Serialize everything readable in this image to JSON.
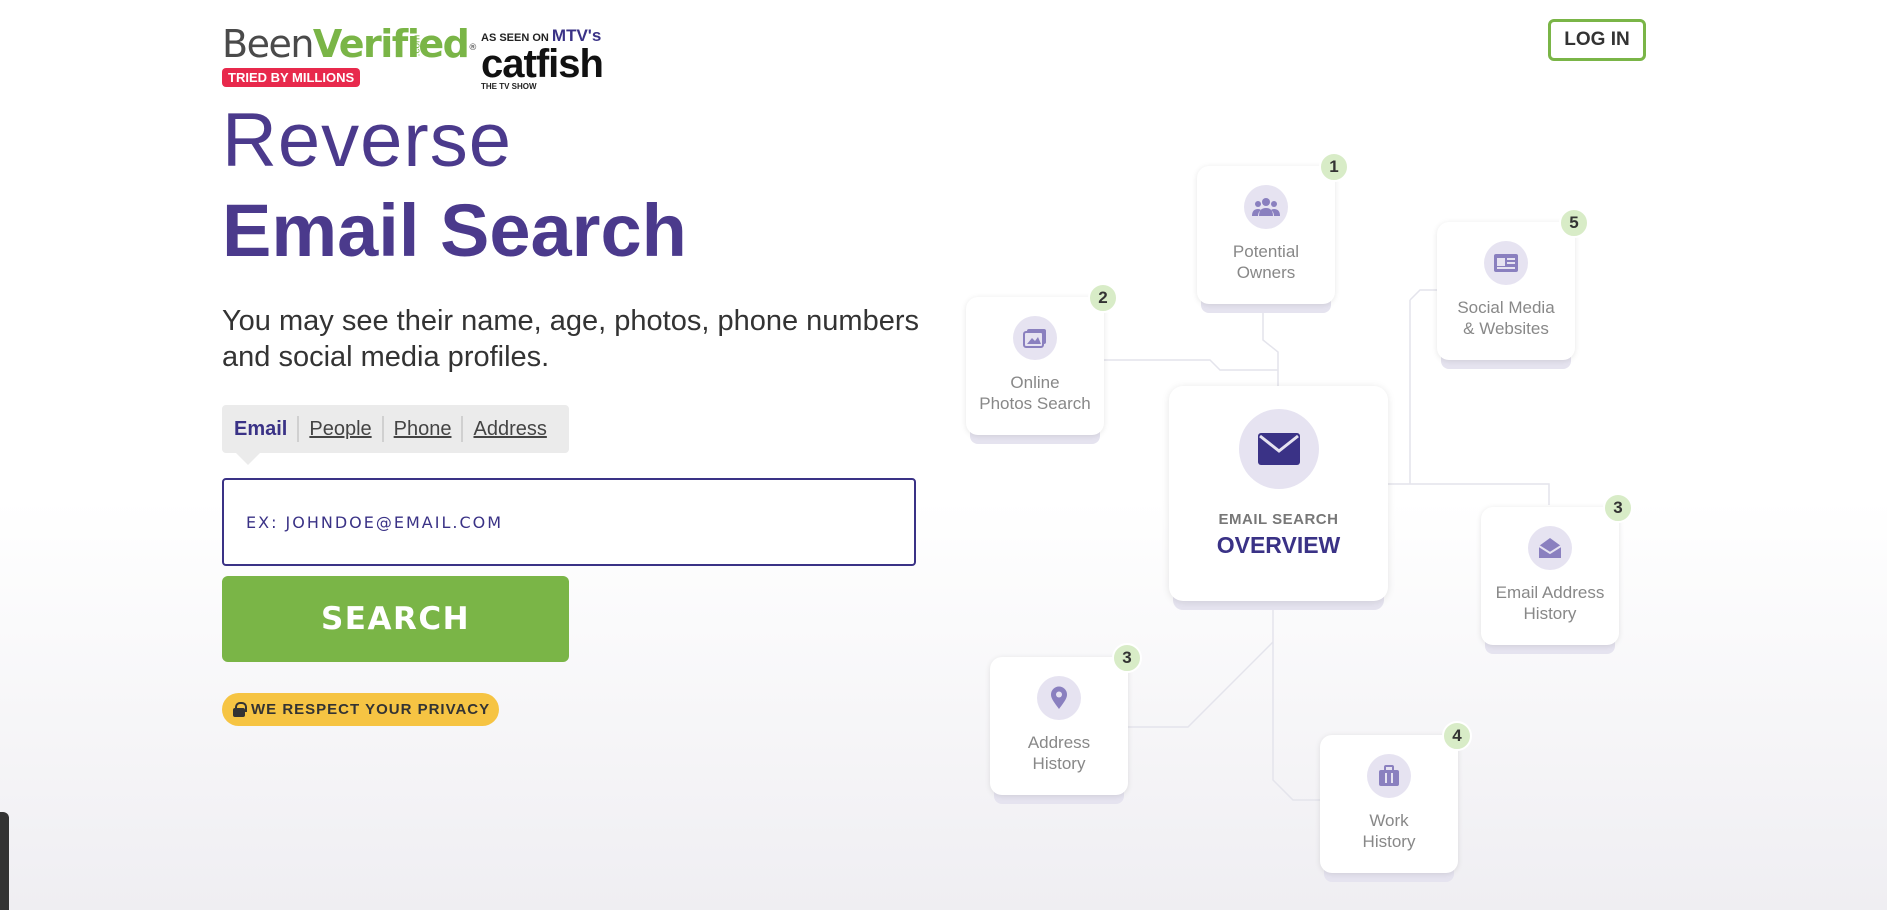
{
  "header": {
    "logo_been": "Been",
    "logo_verified": "Verified",
    "logo_com": ".com",
    "logo_reg": "®",
    "tried_badge": "TRIED BY MILLIONS",
    "as_seen_on": "AS SEEN ON",
    "mtv": "MTV's",
    "show_name": "catfish",
    "show_sub": "THE TV SHOW",
    "login_label": "LOG IN"
  },
  "hero": {
    "title_light": "Reverse",
    "title_bold": "Email Search",
    "subtitle": "You may see their name, age, photos, phone numbers and social media profiles."
  },
  "search": {
    "tabs": [
      "Email",
      "People",
      "Phone",
      "Address"
    ],
    "active_tab": "Email",
    "placeholder": "EX: JOHNDOE@EMAIL.COM",
    "button_label": "SEARCH",
    "privacy": "WE RESPECT YOUR PRIVACY"
  },
  "diagram": {
    "center": {
      "small": "EMAIL SEARCH",
      "big": "OVERVIEW",
      "icon": "envelope-icon"
    },
    "nodes": [
      {
        "id": "owners",
        "label1": "Potential",
        "label2": "Owners",
        "count": "1",
        "icon": "users-icon"
      },
      {
        "id": "photos",
        "label1": "Online",
        "label2": "Photos Search",
        "count": "2",
        "icon": "photo-icon"
      },
      {
        "id": "social",
        "label1": "Social Media",
        "label2": "& Websites",
        "count": "5",
        "icon": "id-card-icon"
      },
      {
        "id": "emailhist",
        "label1": "Email Address",
        "label2": "History",
        "count": "3",
        "icon": "open-envelope-icon"
      },
      {
        "id": "address",
        "label1": "Address",
        "label2": "History",
        "count": "3",
        "icon": "map-pin-icon"
      },
      {
        "id": "work",
        "label1": "Work",
        "label2": "History",
        "count": "4",
        "icon": "briefcase-icon"
      }
    ]
  },
  "colors": {
    "brand_purple": "#3a3286",
    "title_purple": "#4b3a8c",
    "brand_green": "#7ab547",
    "badge_red": "#e8294c",
    "privacy_yellow": "#f6c443",
    "count_green": "#d8ecc7",
    "icon_bg": "#e6e3f1",
    "icon_fg": "#8a80bf"
  }
}
